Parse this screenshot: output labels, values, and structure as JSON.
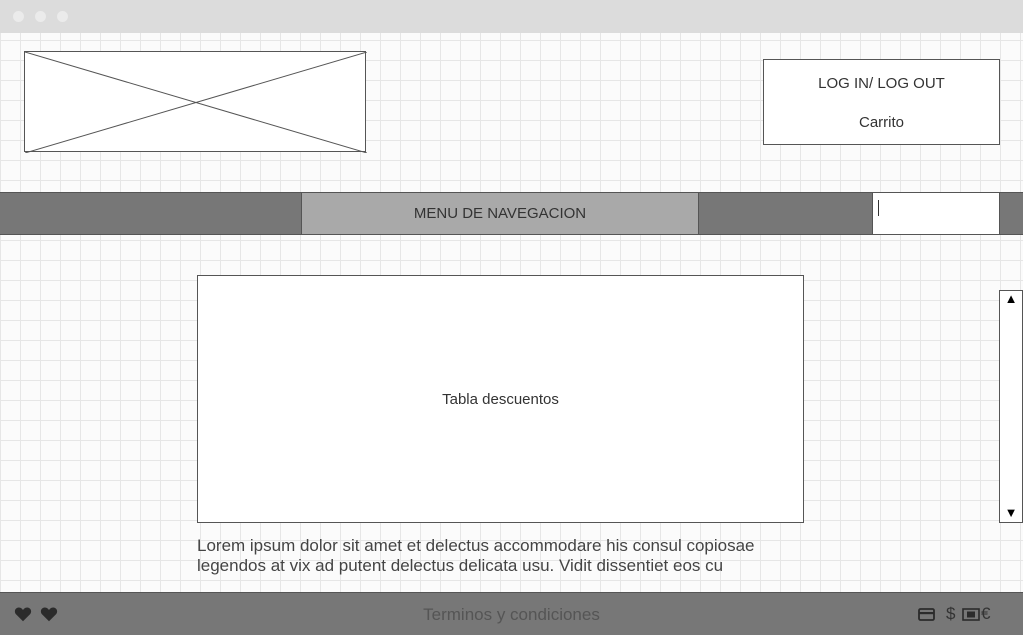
{
  "header": {
    "account": {
      "login_label": "LOG IN/ LOG OUT",
      "cart_label": "Carrito"
    }
  },
  "navbar": {
    "menu_label": "MENU DE NAVEGACION",
    "search_value": ""
  },
  "main": {
    "table_label": "Tabla descuentos",
    "body_text": "Lorem ipsum dolor sit amet et delectus accommodare his consul copiosae legendos at vix ad putent delectus delicata usu. Vidit dissentiet eos cu"
  },
  "scrollbar": {
    "up_arrow": "▲",
    "down_arrow": "▼"
  },
  "footer": {
    "terms_label": "Terminos y condiciones",
    "left_icons": [
      "heart-icon",
      "heart-icon"
    ],
    "payment_icons": [
      "credit-card-icon",
      "dollar-icon",
      "banknote-icon",
      "euro-icon"
    ],
    "dollar_symbol": "$",
    "euro_symbol": "€"
  },
  "colors": {
    "navbar_bg": "#777777",
    "menu_bg": "#a9a9a9",
    "footer_bg": "#777777",
    "titlebar_bg": "#dcdcdc"
  }
}
